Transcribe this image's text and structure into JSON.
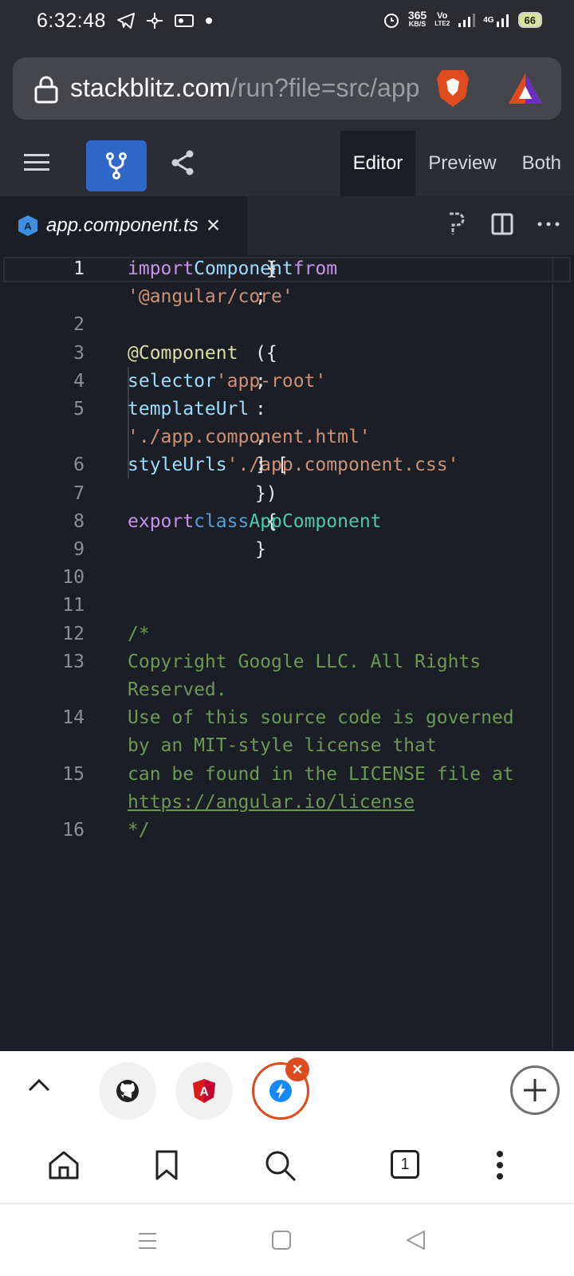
{
  "status_bar": {
    "time": "6:32:48",
    "net_speed_value": "365",
    "net_speed_unit": "KB/S",
    "volte_top": "Vo",
    "volte_bottom": "LTE2",
    "network": "4G",
    "battery": "66"
  },
  "address_bar": {
    "url_host": "stackblitz.com",
    "url_rest": "/run?file=src/app"
  },
  "toolbar": {
    "view_tabs": [
      "Editor",
      "Preview",
      "Both"
    ]
  },
  "editor": {
    "file_tab": "app.component.ts",
    "lines": [
      {
        "n": "1",
        "active": true,
        "segments": [
          [
            "kw",
            "import"
          ],
          [
            "tx",
            " { "
          ],
          [
            "id",
            "Component"
          ],
          [
            "tx",
            " } "
          ],
          [
            "kw",
            "from"
          ]
        ]
      },
      {
        "n": "",
        "segments": [
          [
            "str",
            "'@angular/core'"
          ],
          [
            "tx",
            ";"
          ]
        ]
      },
      {
        "n": "2",
        "segments": []
      },
      {
        "n": "3",
        "segments": [
          [
            "fn",
            "@Component"
          ],
          [
            "tx",
            "({"
          ]
        ]
      },
      {
        "n": "4",
        "segments": [
          [
            "tx",
            "  "
          ],
          [
            "id",
            "selector"
          ],
          [
            "tx",
            ": "
          ],
          [
            "str",
            "'app-root'"
          ],
          [
            "tx",
            ","
          ]
        ]
      },
      {
        "n": "5",
        "segments": [
          [
            "tx",
            "  "
          ],
          [
            "id",
            "templateUrl"
          ],
          [
            "tx",
            ":"
          ]
        ]
      },
      {
        "n": "",
        "segments": [
          [
            "tx",
            "  "
          ],
          [
            "str",
            "'./app.component.html'"
          ],
          [
            "tx",
            ","
          ]
        ]
      },
      {
        "n": "6",
        "segments": [
          [
            "tx",
            "  "
          ],
          [
            "id",
            "styleUrls"
          ],
          [
            "tx",
            ": ["
          ],
          [
            "str",
            "'./app.component.css'"
          ],
          [
            "tx",
            "]"
          ]
        ]
      },
      {
        "n": "7",
        "segments": [
          [
            "tx",
            "})"
          ]
        ]
      },
      {
        "n": "8",
        "segments": [
          [
            "kw",
            "export"
          ],
          [
            "tx",
            " "
          ],
          [
            "kw2",
            "class"
          ],
          [
            "tx",
            " "
          ],
          [
            "cls",
            "AppComponent"
          ],
          [
            "tx",
            " {"
          ]
        ]
      },
      {
        "n": "9",
        "segments": [
          [
            "tx",
            "}"
          ]
        ]
      },
      {
        "n": "10",
        "segments": []
      },
      {
        "n": "11",
        "segments": []
      },
      {
        "n": "12",
        "segments": [
          [
            "com",
            "/*"
          ]
        ]
      },
      {
        "n": "13",
        "segments": [
          [
            "com",
            "Copyright Google LLC. All Rights"
          ]
        ]
      },
      {
        "n": "",
        "segments": [
          [
            "com",
            "Reserved."
          ]
        ]
      },
      {
        "n": "14",
        "segments": [
          [
            "com",
            "Use of this source code is governed"
          ]
        ]
      },
      {
        "n": "",
        "segments": [
          [
            "com",
            "by an MIT-style license that"
          ]
        ]
      },
      {
        "n": "15",
        "segments": [
          [
            "com",
            "can be found in the LICENSE file at"
          ]
        ]
      },
      {
        "n": "",
        "segments": [
          [
            "link",
            "https://angular.io/license"
          ]
        ]
      },
      {
        "n": "16",
        "segments": [
          [
            "com",
            "*/"
          ]
        ]
      }
    ]
  },
  "browser_nav": {
    "tab_count": "1"
  },
  "colors": {
    "accent": "#2f68c8",
    "brave_orange": "#e04a1f",
    "editor_bg": "#1b1e25"
  }
}
